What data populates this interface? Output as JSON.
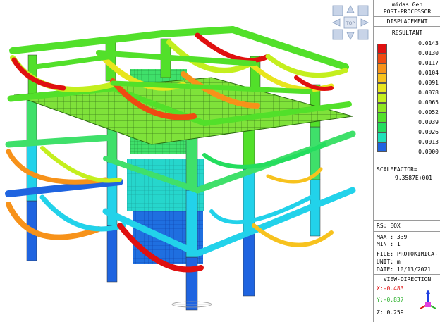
{
  "legend": {
    "program": "midas Gen",
    "module": "POST-PROCESSOR",
    "result_type": "DISPLACEMENT",
    "component": "RESULTANT",
    "levels": [
      "0.0143",
      "0.0130",
      "0.0117",
      "0.0104",
      "0.0091",
      "0.0078",
      "0.0065",
      "0.0052",
      "0.0039",
      "0.0026",
      "0.0013",
      "0.0000"
    ],
    "colors": [
      "#e01010",
      "#ef4a12",
      "#f7921a",
      "#f7c21e",
      "#e8e51e",
      "#c4ef1e",
      "#8ee622",
      "#52e02a",
      "#24dd5e",
      "#20e0b8",
      "#1ec6f0",
      "#1f64e0"
    ],
    "scale_factor_label": "SCALEFACTOR=",
    "scale_factor_value": "9.3587E+001"
  },
  "info": {
    "rs": "RS: EQX",
    "max": "MAX : 339",
    "min": "MIN : 1",
    "file": "FILE: PROTOKIMICA~",
    "unit": "UNIT: m",
    "date": "DATE: 10/13/2021",
    "view_direction": "VIEW-DIRECTION",
    "x": "X:-0.483",
    "y": "Y:-0.837",
    "z": "Z: 0.259"
  },
  "navcube": {
    "center": "TOP"
  },
  "colors": {
    "beam_blue": "#1f64e0",
    "beam_cyan": "#22d2ea",
    "beam_green": "#52e02a",
    "beam_red": "#e01010"
  }
}
